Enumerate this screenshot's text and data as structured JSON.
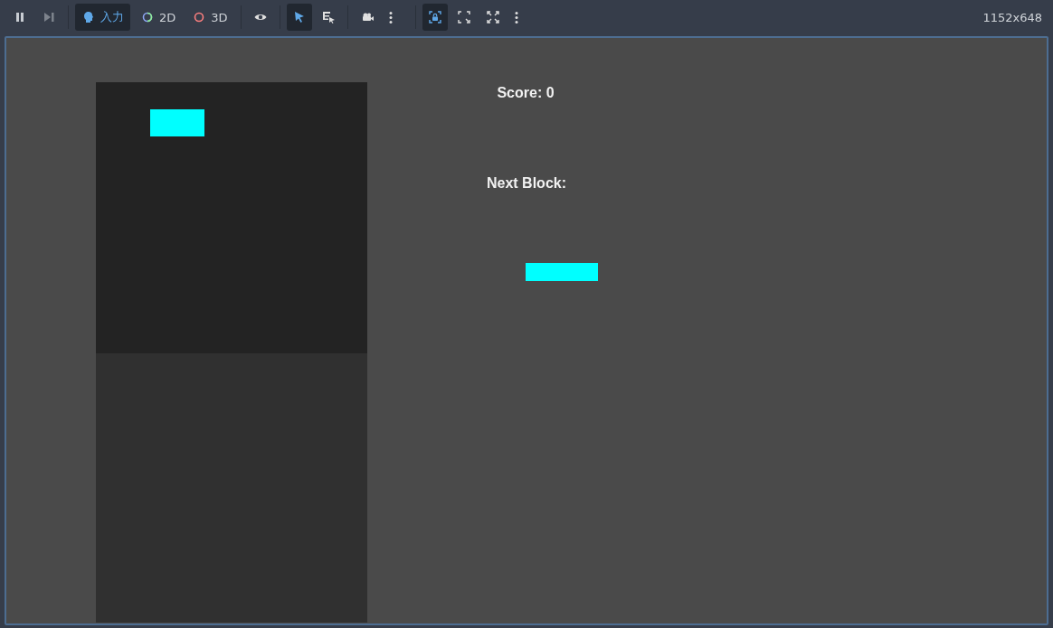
{
  "toolbar": {
    "items": [
      {
        "kind": "icon",
        "selected": false
      },
      {
        "kind": "icon",
        "selected": false
      },
      {
        "kind": "separator"
      },
      {
        "kind": "labeled",
        "label": "入力",
        "selected": true
      },
      {
        "kind": "labeled",
        "label": "2D",
        "selected": false
      },
      {
        "kind": "labeled",
        "label": "3D",
        "selected": false
      },
      {
        "kind": "separator"
      },
      {
        "kind": "icon",
        "selected": false
      },
      {
        "kind": "separator"
      },
      {
        "kind": "icon",
        "selected": true
      },
      {
        "kind": "icon",
        "selected": false
      },
      {
        "kind": "separator"
      },
      {
        "kind": "icon",
        "selected": false
      },
      {
        "kind": "icon",
        "selected": false
      },
      {
        "kind": "separator"
      },
      {
        "kind": "icon",
        "selected": true
      },
      {
        "kind": "icon",
        "selected": false
      },
      {
        "kind": "icon",
        "selected": false
      },
      {
        "kind": "icon",
        "selected": false
      }
    ],
    "resolution": "1152x648"
  },
  "game": {
    "score_label": "Score: 0",
    "next_label": "Next Block:"
  }
}
